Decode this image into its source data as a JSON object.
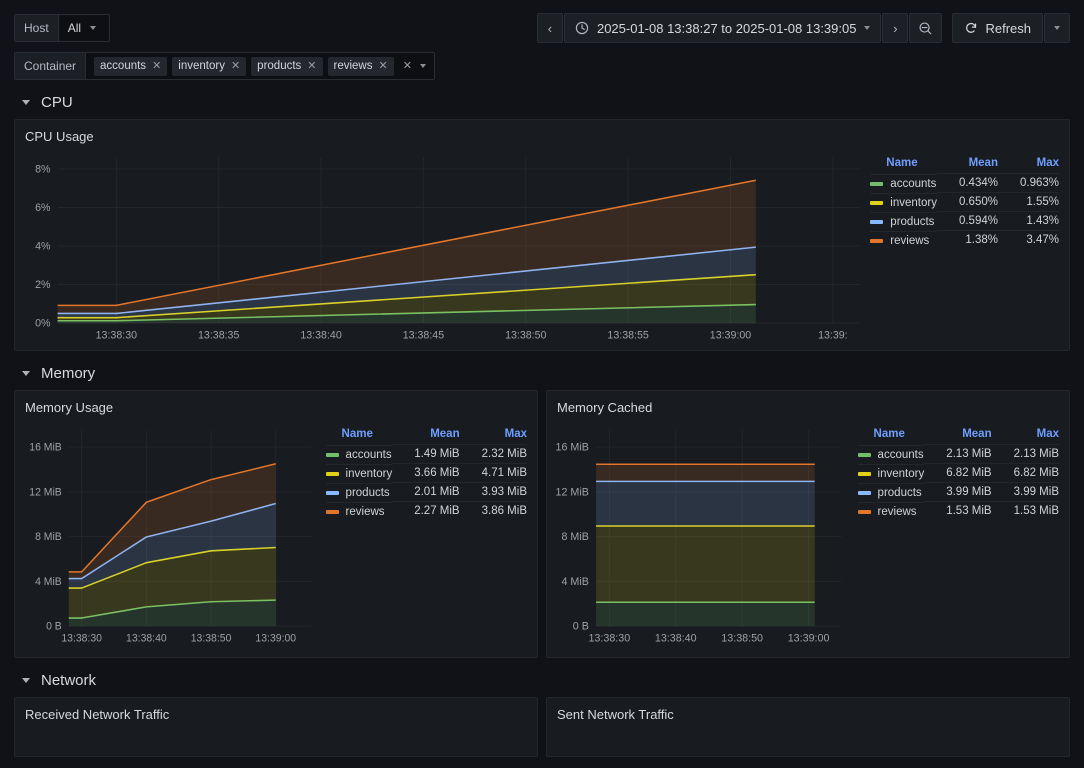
{
  "toolbar": {
    "host_var": {
      "label": "Host",
      "value": "All"
    },
    "container_var": {
      "label": "Container",
      "chips": [
        "accounts",
        "inventory",
        "products",
        "reviews"
      ],
      "chip_remove_icon": "✕",
      "clear_icon": "✕"
    },
    "time_picker": {
      "prev_icon": "‹",
      "next_icon": "›",
      "clock_icon": "clock",
      "range_text": "2025-01-08 13:38:27 to 2025-01-08 13:39:05",
      "zoom_out_icon": "zoom-out"
    },
    "refresh": {
      "label": "Refresh",
      "icon": "refresh"
    }
  },
  "sections": [
    {
      "id": "cpu",
      "title": "CPU"
    },
    {
      "id": "memory",
      "title": "Memory"
    },
    {
      "id": "network",
      "title": "Network"
    }
  ],
  "panels": {
    "cpu_usage": {
      "title": "CPU Usage"
    },
    "memory_usage": {
      "title": "Memory Usage"
    },
    "memory_cached": {
      "title": "Memory Cached"
    },
    "received_network_traffic": {
      "title": "Received Network Traffic"
    },
    "sent_network_traffic": {
      "title": "Sent Network Traffic"
    }
  },
  "legend_headers": {
    "name": "Name",
    "mean": "Mean",
    "max": "Max"
  },
  "colors": {
    "accounts": "#73bf69",
    "inventory": "#e0d219",
    "products": "#8ab8ff",
    "reviews": "#e3762b",
    "accent_blue": "#6e9fff",
    "panel_bg": "#181b1f",
    "page_bg": "#111217",
    "grid": "#23262b"
  },
  "chart_data": [
    {
      "id": "cpu_usage",
      "type": "area",
      "title": "CPU Usage",
      "stacked": true,
      "xlabel": "",
      "ylabel": "",
      "ylim": [
        0,
        8.6
      ],
      "ytick_labels": [
        "0%",
        "2%",
        "4%",
        "6%",
        "8%"
      ],
      "ytick_values": [
        0,
        2,
        4,
        6,
        8
      ],
      "xtick_labels": [
        "13:38:30",
        "13:38:35",
        "13:38:40",
        "13:38:45",
        "13:38:50",
        "13:38:55",
        "13:39:00",
        "13:39:"
      ],
      "x": [
        "13:38:27",
        "13:38:30",
        "13:39:00"
      ],
      "grid": true,
      "legend_position": "right",
      "series": [
        {
          "name": "accounts",
          "color": "#73bf69",
          "mean": "0.434%",
          "max": "0.963%",
          "values": [
            0.12,
            0.12,
            0.96
          ]
        },
        {
          "name": "inventory",
          "color": "#e0d219",
          "mean": "0.650%",
          "max": "1.55%",
          "values": [
            0.16,
            0.16,
            1.55
          ]
        },
        {
          "name": "products",
          "color": "#8ab8ff",
          "mean": "0.594%",
          "max": "1.43%",
          "values": [
            0.22,
            0.22,
            1.43
          ]
        },
        {
          "name": "reviews",
          "color": "#e3762b",
          "mean": "1.38%",
          "max": "3.47%",
          "values": [
            0.42,
            0.42,
            3.47
          ]
        }
      ]
    },
    {
      "id": "memory_usage",
      "type": "area",
      "title": "Memory Usage",
      "stacked": true,
      "ylim": [
        0,
        17.5
      ],
      "ytick_labels": [
        "0 B",
        "4 MiB",
        "8 MiB",
        "12 MiB",
        "16 MiB"
      ],
      "ytick_values": [
        0,
        4,
        8,
        12,
        16
      ],
      "xtick_labels": [
        "13:38:30",
        "13:38:40",
        "13:38:50",
        "13:39:00"
      ],
      "grid": true,
      "legend_position": "right",
      "series": [
        {
          "name": "accounts",
          "color": "#73bf69",
          "mean": "1.49 MiB",
          "max": "2.32 MiB",
          "values": [
            0.72,
            0.72,
            2.18,
            2.32
          ]
        },
        {
          "name": "inventory",
          "color": "#e0d219",
          "mean": "3.66 MiB",
          "max": "4.71 MiB",
          "values": [
            2.68,
            2.68,
            4.55,
            4.71
          ]
        },
        {
          "name": "products",
          "color": "#8ab8ff",
          "mean": "2.01 MiB",
          "max": "3.93 MiB",
          "values": [
            0.85,
            0.85,
            2.65,
            3.93
          ]
        },
        {
          "name": "reviews",
          "color": "#e3762b",
          "mean": "2.27 MiB",
          "max": "3.86 MiB",
          "values": [
            0.6,
            0.6,
            3.72,
            3.55
          ]
        }
      ]
    },
    {
      "id": "memory_cached",
      "type": "area",
      "title": "Memory Cached",
      "stacked": true,
      "ylim": [
        0,
        17.5
      ],
      "ytick_labels": [
        "0 B",
        "4 MiB",
        "8 MiB",
        "12 MiB",
        "16 MiB"
      ],
      "ytick_values": [
        0,
        4,
        8,
        12,
        16
      ],
      "xtick_labels": [
        "13:38:30",
        "13:38:40",
        "13:38:50",
        "13:39:00"
      ],
      "grid": true,
      "legend_position": "right",
      "series": [
        {
          "name": "accounts",
          "color": "#73bf69",
          "mean": "2.13 MiB",
          "max": "2.13 MiB",
          "values": [
            2.13,
            2.13
          ]
        },
        {
          "name": "inventory",
          "color": "#e0d219",
          "mean": "6.82 MiB",
          "max": "6.82 MiB",
          "values": [
            6.82,
            6.82
          ]
        },
        {
          "name": "products",
          "color": "#8ab8ff",
          "mean": "3.99 MiB",
          "max": "3.99 MiB",
          "values": [
            3.99,
            3.99
          ]
        },
        {
          "name": "reviews",
          "color": "#e3762b",
          "mean": "1.53 MiB",
          "max": "1.53 MiB",
          "values": [
            1.53,
            1.53
          ]
        }
      ]
    }
  ]
}
